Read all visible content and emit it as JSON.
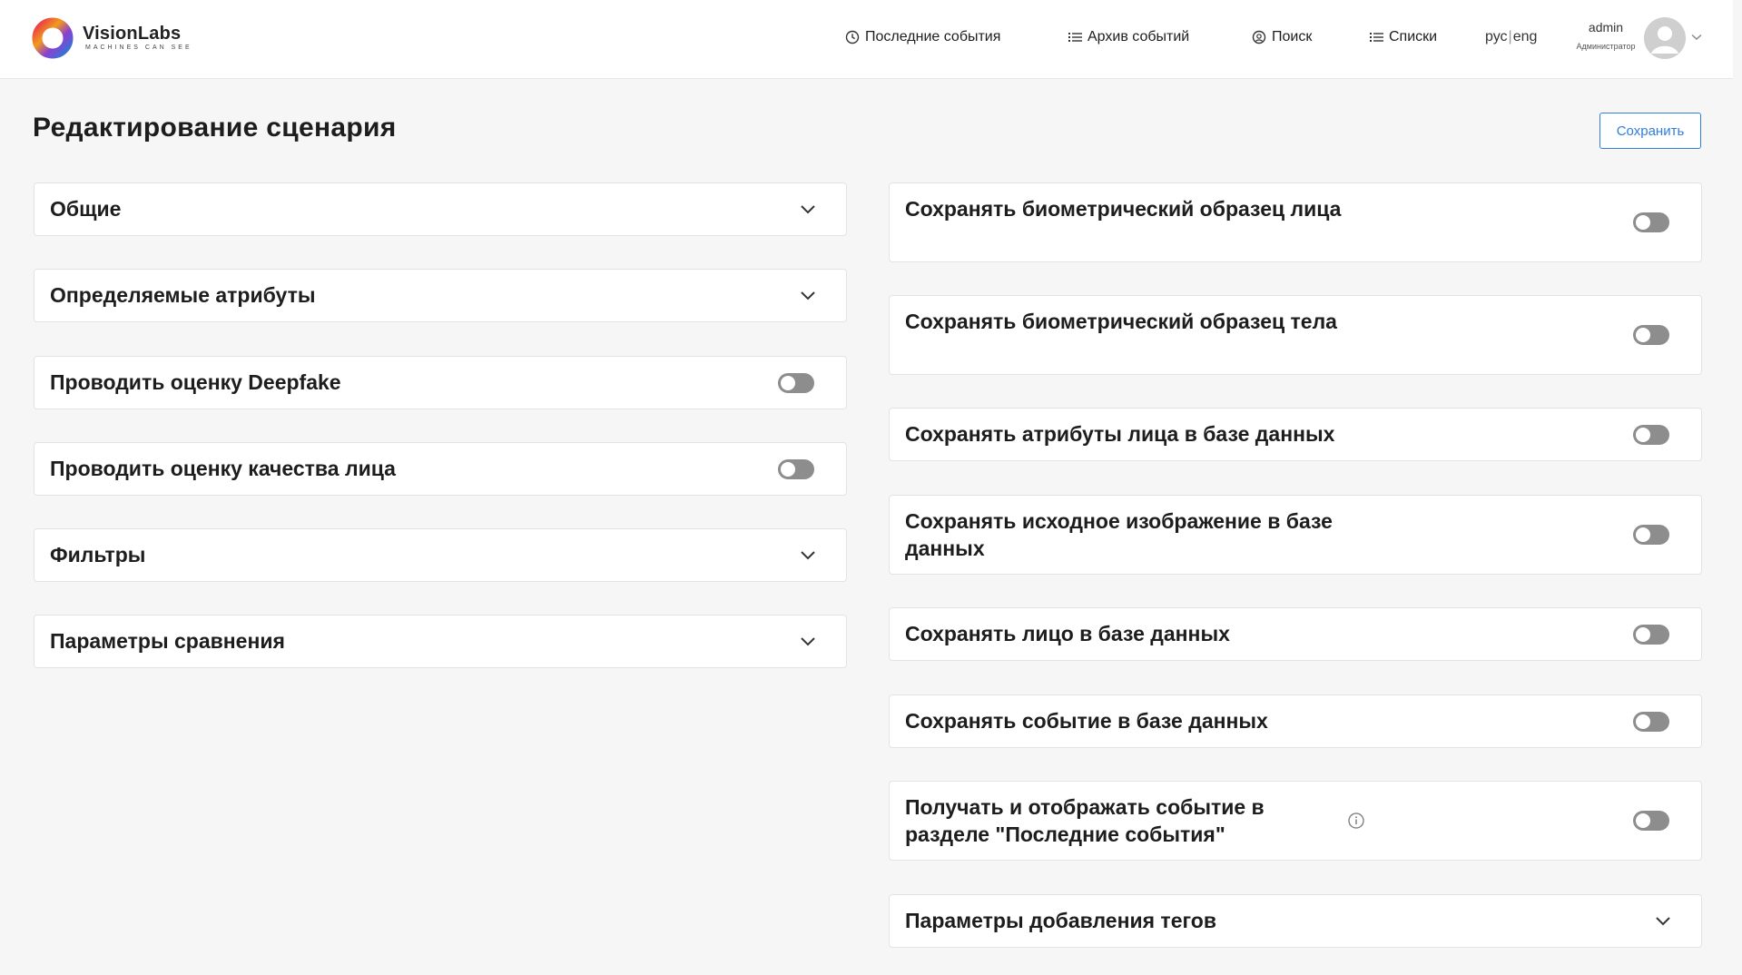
{
  "brand": {
    "name": "VisionLabs",
    "tagline": "MACHINES CAN SEE"
  },
  "nav": {
    "recent_events": "Последние события",
    "events_archive": "Архив событий",
    "search": "Поиск",
    "lists": "Списки",
    "lang_ru": "рус",
    "lang_separator": "|",
    "lang_en": "eng"
  },
  "user": {
    "name": "admin",
    "role": "Администратор"
  },
  "page": {
    "title": "Редактирование сценария",
    "save_label": "Сохранить"
  },
  "left_sections": {
    "general": "Общие",
    "attributes": "Определяемые атрибуты",
    "deepfake": "Проводить оценку Deepfake",
    "face_quality": "Проводить оценку качества лица",
    "filters": "Фильтры",
    "matching": "Параметры сравнения"
  },
  "right_sections": {
    "save_face_sample": "Сохранять биометрический образец лица",
    "save_body_sample": "Сохранять биометрический образец тела",
    "save_face_attributes": "Сохранять атрибуты лица в базе данных",
    "save_source_image": "Сохранять исходное изображение в базе данных",
    "save_face": "Сохранять лицо в базе данных",
    "save_event": "Сохранять событие в базе данных",
    "show_recent": "Получать и отображать событие в разделе \"Последние события\"",
    "tag_params": "Параметры добавления тегов"
  },
  "toggles": {
    "deepfake": false,
    "face_quality": false,
    "save_face_sample": false,
    "save_body_sample": false,
    "save_face_attributes": false,
    "save_source_image": false,
    "save_face": false,
    "save_event": false,
    "show_recent": false
  },
  "colors": {
    "accent": "#2f7de1",
    "toggle_off": "#8d8d8d",
    "background": "#f6f6f6"
  }
}
